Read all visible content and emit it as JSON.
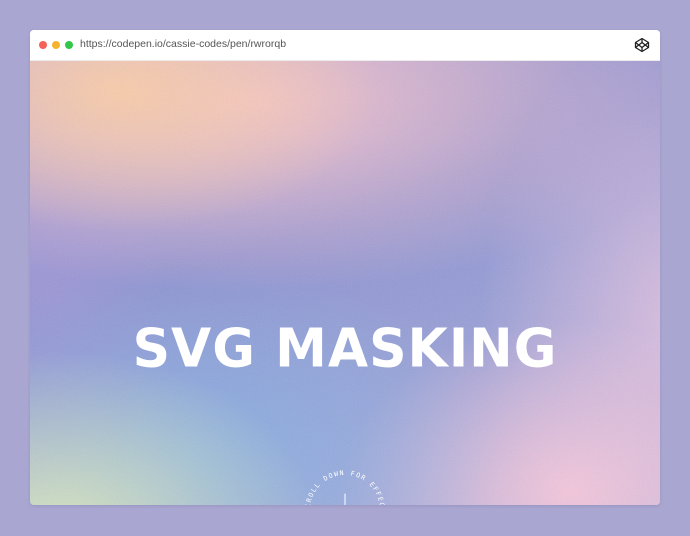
{
  "window": {
    "url": "https://codepen.io/cassie-codes/pen/rwrorqb",
    "controls": [
      "close",
      "minimize",
      "maximize"
    ],
    "icon": "codepen-icon"
  },
  "page": {
    "headline": "SVG MASKING",
    "scroll_hint": "SCROLL DOWN FOR EFFECT",
    "arrow_icon": "arrow-down-icon"
  },
  "colors": {
    "backdrop": "#a9a7d1",
    "dot_red": "#f4625a",
    "dot_yellow": "#f7b32f",
    "dot_green": "#32c748",
    "gradient_peach": "#facdaa",
    "gradient_pink": "#f6c4ce",
    "gradient_periwinkle": "#8e92d2",
    "gradient_blue": "#82b4e6",
    "gradient_lime": "#dcebbe",
    "headline": "#ffffff"
  }
}
